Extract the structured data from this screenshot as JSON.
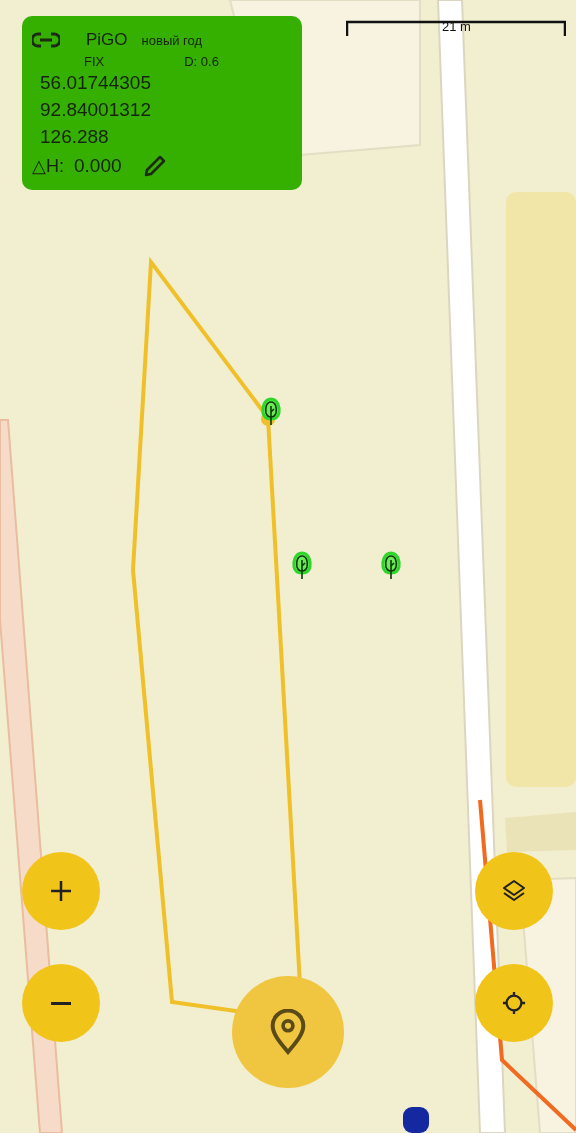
{
  "status_card": {
    "device": "PiGO",
    "project": "новый год",
    "fix": "FIX",
    "dop": "D: 0.6",
    "latitude": "56.01744305",
    "longitude": "92.84001312",
    "altitude": "126.288",
    "dh_label": "△H:",
    "dh_value": "0.000"
  },
  "scale_bar": {
    "label": "21 m"
  },
  "buttons": [
    {
      "kind": "zoom-in"
    },
    {
      "kind": "zoom-out"
    },
    {
      "kind": "layers"
    },
    {
      "kind": "locate"
    },
    {
      "kind": "add-point"
    }
  ]
}
